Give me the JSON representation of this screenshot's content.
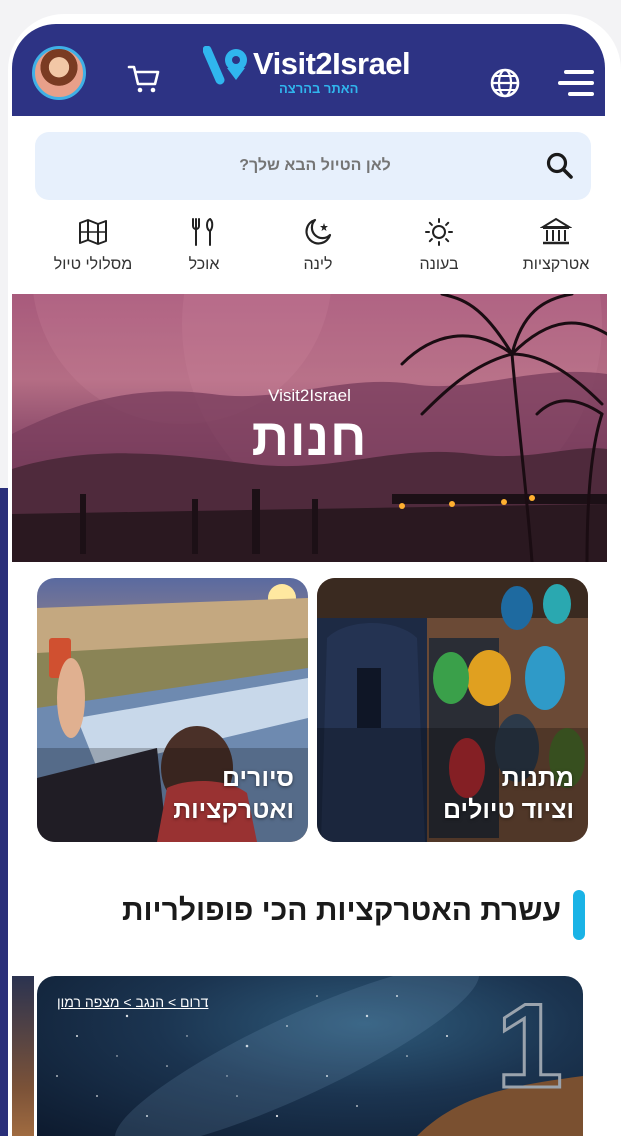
{
  "header": {
    "logo_text": "Visit2Israel",
    "logo_sub": "האתר בהרצה",
    "brand_color": "#2d3384",
    "accent_color": "#30b6ee",
    "icons": [
      "avatar",
      "cart-icon",
      "globe-icon",
      "menu-icon"
    ]
  },
  "search": {
    "placeholder": "לאן הטיול הבא שלך?"
  },
  "categories": [
    {
      "label": "אטרקציות",
      "icon": "museum-icon"
    },
    {
      "label": "בעונה",
      "icon": "sun-icon"
    },
    {
      "label": "לינה",
      "icon": "moon-star-icon"
    },
    {
      "label": "אוכל",
      "icon": "utensils-icon"
    },
    {
      "label": "מסלולי טיול",
      "icon": "map-icon"
    }
  ],
  "hero": {
    "small_text": "Visit2Israel",
    "title": "חנות"
  },
  "tiles": [
    {
      "line1": "מתנות",
      "line2": "וציוד טיולים"
    },
    {
      "line1": "סיורים",
      "line2": "ואטרקציות"
    }
  ],
  "section": {
    "title": "עשרת האטרקציות הכי פופולריות",
    "bar_color": "#1ab3e6"
  },
  "card": {
    "breadcrumb": "דרום > הנגב > מצפה רמון",
    "rank": "1"
  }
}
